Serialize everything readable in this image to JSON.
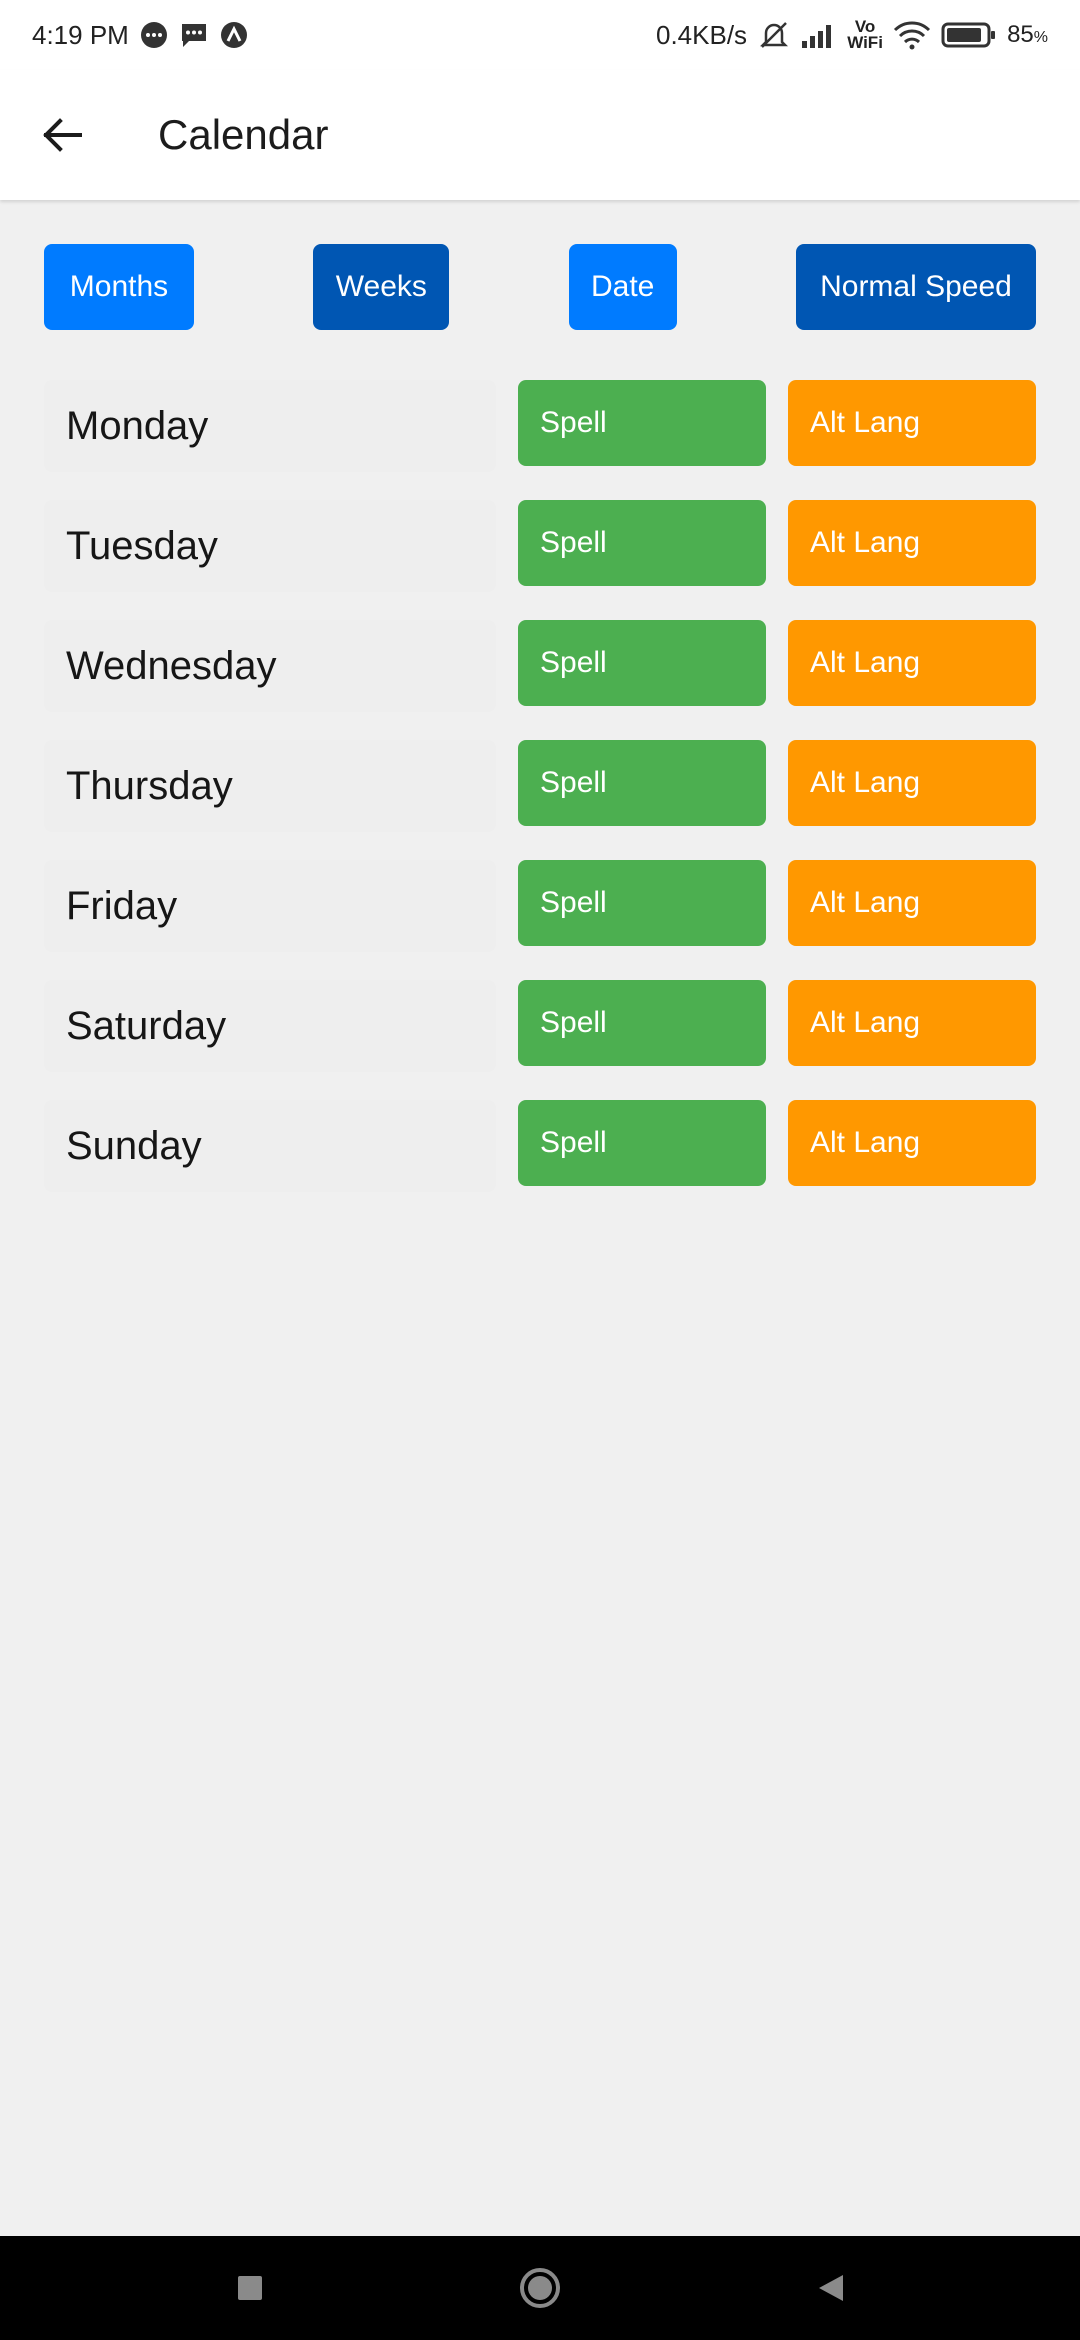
{
  "status_bar": {
    "time": "4:19 PM",
    "net_speed": "0.4KB/s",
    "wifi_label": "Vo WiFi",
    "battery": "85",
    "icons": [
      "chat-bubble-icon",
      "message-icon",
      "app-a-icon",
      "mute-icon",
      "signal-icon",
      "vowifi-icon",
      "wifi-icon",
      "battery-icon"
    ]
  },
  "app_bar": {
    "title": "Calendar",
    "back_icon": "arrow-left-icon"
  },
  "toolbar": {
    "months_label": "Months",
    "weeks_label": "Weeks",
    "date_label": "Date",
    "speed_label": "Normal Speed"
  },
  "days": [
    {
      "name": "Monday",
      "spell": "Spell",
      "alt": "Alt Lang"
    },
    {
      "name": "Tuesday",
      "spell": "Spell",
      "alt": "Alt Lang"
    },
    {
      "name": "Wednesday",
      "spell": "Spell",
      "alt": "Alt Lang"
    },
    {
      "name": "Thursday",
      "spell": "Spell",
      "alt": "Alt Lang"
    },
    {
      "name": "Friday",
      "spell": "Spell",
      "alt": "Alt Lang"
    },
    {
      "name": "Saturday",
      "spell": "Spell",
      "alt": "Alt Lang"
    },
    {
      "name": "Sunday",
      "spell": "Spell",
      "alt": "Alt Lang"
    }
  ],
  "colors": {
    "months_button": "#007bff",
    "weeks_button": "#0056b3",
    "date_button": "#007bff",
    "speed_button": "#0056b3",
    "spell_button": "#4caf50",
    "alt_button": "#ff9800",
    "background": "#f0f0f0"
  },
  "nav": {
    "icons": [
      "recents-square-icon",
      "home-circle-icon",
      "back-triangle-icon"
    ]
  }
}
